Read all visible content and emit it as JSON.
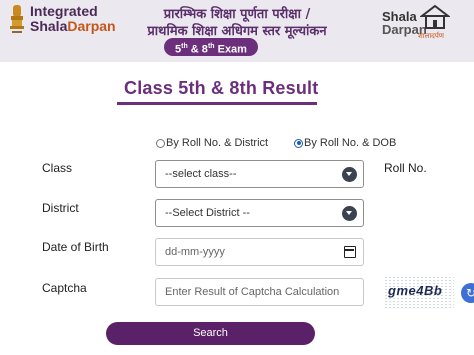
{
  "header": {
    "brand_line1": "Integrated",
    "brand_line2_a": "Shala",
    "brand_line2_b": "Darpan",
    "hindi_line1": "प्रारम्भिक शिक्षा पूर्णता परीक्षा /",
    "hindi_line2": "प्राथमिक शिक्षा अधिगम स्तर मूल्यांकन",
    "exam_badge_a": "5",
    "exam_badge_sup1": "th",
    "exam_badge_mid": " & 8",
    "exam_badge_sup2": "th",
    "exam_badge_end": " Exam",
    "logo_line1": "Shala",
    "logo_line2": "Darpan",
    "logo_sub": "शालादर्पण"
  },
  "title": "Class 5th & 8th Result",
  "search_mode": {
    "options": [
      "By Roll No. & District",
      "By Roll No. & DOB"
    ],
    "selected": "By Roll No. & DOB"
  },
  "form": {
    "class_label": "Class",
    "class_value": "--select class--",
    "roll_label": "Roll No.",
    "district_label": "District",
    "district_value": "--Select District --",
    "dob_label": "Date of Birth",
    "dob_placeholder": "dd-mm-yyyy",
    "captcha_label": "Captcha",
    "captcha_placeholder": "Enter Result of Captcha Calculation",
    "captcha_text": "gme4Bb"
  },
  "search_button": "Search",
  "icons": {
    "emblem": "national-emblem-icon",
    "logo": "school-building-icon",
    "calendar": "calendar-icon",
    "refresh": "refresh-icon"
  },
  "colors": {
    "brand_purple": "#6b2f7c",
    "button_purple": "#5b2168",
    "accent_orange": "#c4571a",
    "radio_blue": "#1a5fb4"
  }
}
